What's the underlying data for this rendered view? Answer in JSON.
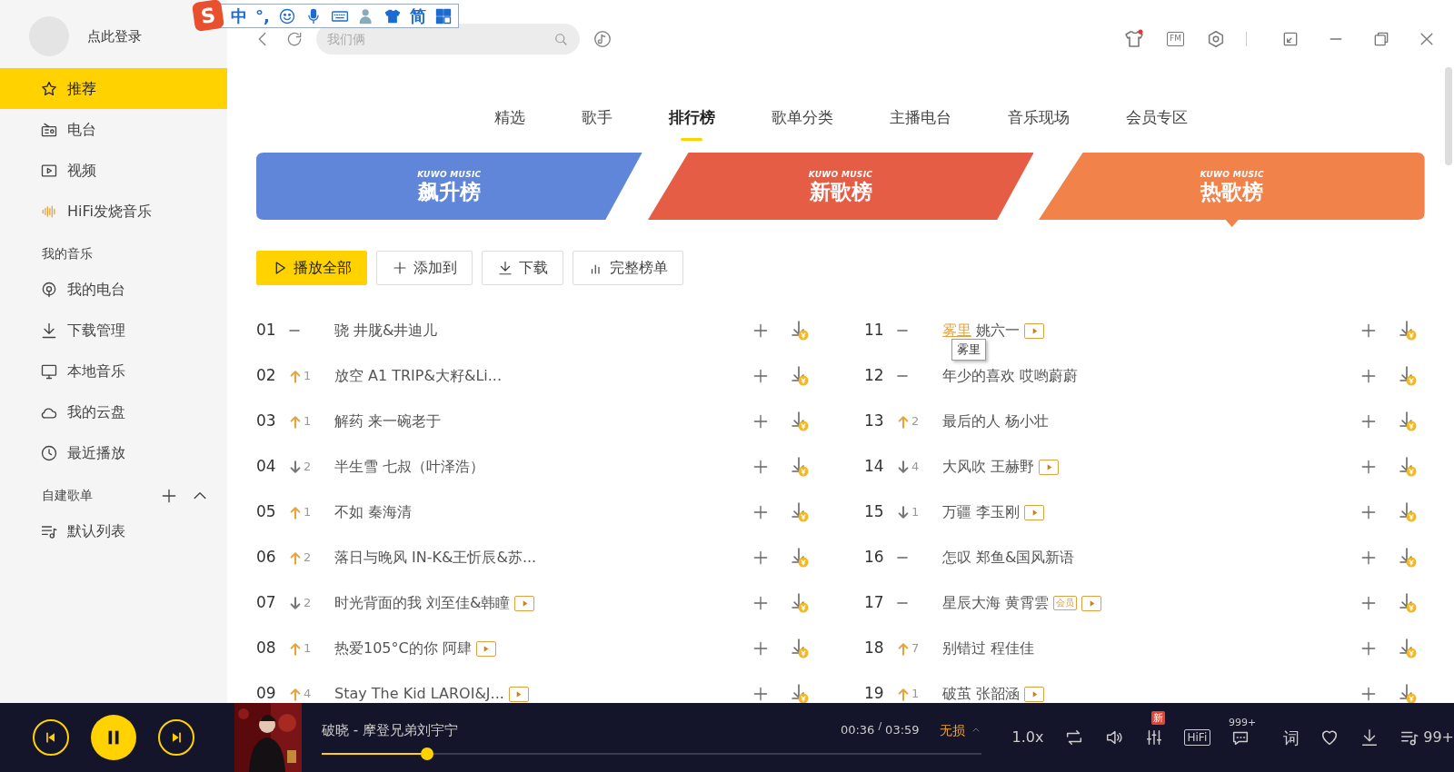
{
  "ime_toolbar": {
    "logo": "S",
    "items": [
      {
        "kind": "text",
        "label": "中"
      },
      {
        "kind": "text",
        "label": "°,"
      },
      {
        "kind": "smiley"
      },
      {
        "kind": "mic"
      },
      {
        "kind": "keyboard"
      },
      {
        "kind": "person"
      },
      {
        "kind": "shirt"
      },
      {
        "kind": "text",
        "label": "简"
      },
      {
        "kind": "grid"
      }
    ]
  },
  "user": {
    "login_label": "点此登录"
  },
  "search": {
    "placeholder": "我们俩"
  },
  "window_controls": {
    "fm_label": "FM",
    "skin_has_dot": true
  },
  "sidebar": {
    "items": [
      {
        "label": "推荐",
        "selected": true
      },
      {
        "label": "电台",
        "selected": false
      },
      {
        "label": "视频",
        "selected": false
      },
      {
        "label": "HiFi发烧音乐",
        "selected": false
      }
    ],
    "my_music": {
      "title": "我的音乐",
      "items": [
        {
          "label": "我的电台",
          "selected": false
        },
        {
          "label": "下载管理",
          "selected": false
        },
        {
          "label": "本地音乐",
          "selected": false
        },
        {
          "label": "我的云盘",
          "selected": false
        },
        {
          "label": "最近播放",
          "selected": false
        }
      ]
    },
    "playlists": {
      "title": "自建歌单",
      "expanded": true,
      "items": [
        {
          "label": "默认列表",
          "selected": false
        }
      ]
    }
  },
  "tabs": [
    {
      "label": "精选",
      "selected": false
    },
    {
      "label": "歌手",
      "selected": false
    },
    {
      "label": "排行榜",
      "selected": true
    },
    {
      "label": "歌单分类",
      "selected": false
    },
    {
      "label": "主播电台",
      "selected": false
    },
    {
      "label": "音乐现场",
      "selected": false
    },
    {
      "label": "会员专区",
      "selected": false
    }
  ],
  "charts": [
    {
      "brand": "KUWO MUSIC",
      "title": "飙升榜",
      "color": "#5f86d8",
      "selected": false
    },
    {
      "brand": "KUWO MUSIC",
      "title": "新歌榜",
      "color": "#e55d45",
      "selected": false
    },
    {
      "brand": "KUWO MUSIC",
      "title": "热歌榜",
      "color": "#f0824a",
      "selected": true
    }
  ],
  "actions": [
    {
      "kind": "play",
      "label": "播放全部"
    },
    {
      "kind": "add",
      "label": "添加到"
    },
    {
      "kind": "download",
      "label": "下载"
    },
    {
      "kind": "bars",
      "label": "完整榜单"
    }
  ],
  "songs": [
    {
      "rank": "01",
      "kind": "flat",
      "title": "骁",
      "artist": "井胧&井迪儿",
      "mv": false,
      "vip": false,
      "hovered": false
    },
    {
      "rank": "02",
      "kind": "up",
      "change": "1",
      "title": "放空",
      "artist": "A1 TRIP&大籽&Li...",
      "mv": false,
      "vip": false,
      "hovered": false
    },
    {
      "rank": "03",
      "kind": "up",
      "change": "1",
      "title": "解药",
      "artist": "来一碗老于",
      "mv": false,
      "vip": false,
      "hovered": false
    },
    {
      "rank": "04",
      "kind": "down",
      "change": "2",
      "title": "半生雪",
      "artist": "七叔（叶泽浩）",
      "mv": false,
      "vip": false,
      "hovered": false
    },
    {
      "rank": "05",
      "kind": "up",
      "change": "1",
      "title": "不如",
      "artist": "秦海清",
      "mv": false,
      "vip": false,
      "hovered": false
    },
    {
      "rank": "06",
      "kind": "up",
      "change": "2",
      "title": "落日与晚风",
      "artist": "IN-K&王忻辰&苏...",
      "mv": false,
      "vip": false,
      "hovered": false
    },
    {
      "rank": "07",
      "kind": "down",
      "change": "2",
      "title": "时光背面的我",
      "artist": "刘至佳&韩瞳",
      "mv": true,
      "vip": false,
      "hovered": false
    },
    {
      "rank": "08",
      "kind": "up",
      "change": "1",
      "title": "热爱105°C的你",
      "artist": "阿肆",
      "mv": true,
      "vip": false,
      "hovered": false
    },
    {
      "rank": "09",
      "kind": "up",
      "change": "4",
      "title": "Stay The Kid",
      "artist": "LAROI&J...",
      "mv": true,
      "vip": false,
      "hovered": false
    },
    {
      "rank": "11",
      "kind": "flat",
      "title": "雾里",
      "artist": "姚六一",
      "mv": true,
      "vip": false,
      "hovered": true,
      "tooltip": "雾里"
    },
    {
      "rank": "12",
      "kind": "flat",
      "title": "年少的喜欢",
      "artist": "哎哟蔚蔚",
      "mv": false,
      "vip": false,
      "hovered": false
    },
    {
      "rank": "13",
      "kind": "up",
      "change": "2",
      "title": "最后的人",
      "artist": "杨小壮",
      "mv": false,
      "vip": false,
      "hovered": false
    },
    {
      "rank": "14",
      "kind": "down",
      "change": "4",
      "title": "大风吹",
      "artist": "王赫野",
      "mv": true,
      "vip": false,
      "hovered": false
    },
    {
      "rank": "15",
      "kind": "down",
      "change": "1",
      "title": "万疆",
      "artist": "李玉刚",
      "mv": true,
      "vip": false,
      "hovered": false
    },
    {
      "rank": "16",
      "kind": "flat",
      "title": "怎叹",
      "artist": "郑鱼&国风新语",
      "mv": false,
      "vip": false,
      "hovered": false
    },
    {
      "rank": "17",
      "kind": "flat",
      "title": "星辰大海",
      "artist": "黄霄雲",
      "mv": true,
      "vip": true,
      "vip_label": "会员",
      "hovered": false
    },
    {
      "rank": "18",
      "kind": "up",
      "change": "7",
      "title": "别错过",
      "artist": "程佳佳",
      "mv": false,
      "vip": false,
      "hovered": false
    },
    {
      "rank": "19",
      "kind": "up",
      "change": "1",
      "title": "破茧",
      "artist": "张韶涵",
      "mv": true,
      "vip": false,
      "hovered": false
    }
  ],
  "player": {
    "playing": true,
    "now_playing": "破晓 - 摩登兄弟刘宇宁",
    "level": 0.16,
    "elapsed": "00:36",
    "separator": "/",
    "duration": "03:59",
    "quality": "无损",
    "speed": "1.0x",
    "eq_badge": "新",
    "hifi": "HiFi",
    "comments": "999+",
    "lyrics": "词",
    "queue_count": "99+"
  }
}
